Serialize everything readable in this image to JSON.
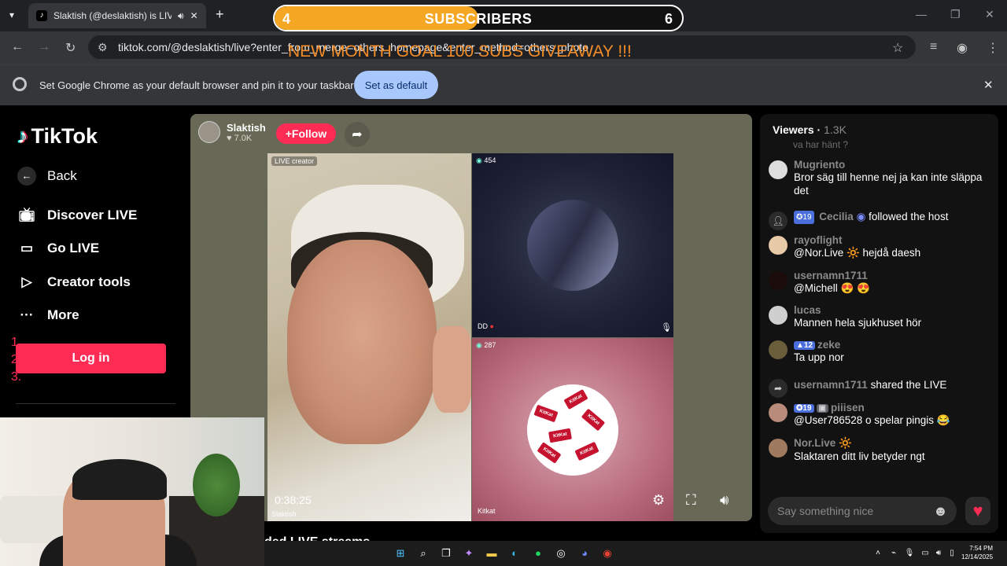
{
  "browser": {
    "tab_title": "Slaktish (@deslaktish) is LIV",
    "url": "tiktok.com/@deslaktish/live?enter_from_merge=others_homepage&enter_method=others_photo",
    "infobar_text": "Set Google Chrome as your default browser and pin it to your taskbar",
    "set_default_label": "Set as default"
  },
  "overlay": {
    "sub_start": "4",
    "sub_label": "SUBSCRIBERS",
    "sub_end": "6",
    "sub_progress": 0.5,
    "goal_text": "NEW MONTH GOAL 100 SUBS GIVEAWAY !!!"
  },
  "sidebar": {
    "logo": "TikTok",
    "back": "Back",
    "items": [
      {
        "label": "Discover LIVE",
        "icon": "tv-icon"
      },
      {
        "label": "Go LIVE",
        "icon": "camera-icon"
      },
      {
        "label": "Creator tools",
        "icon": "play-icon"
      },
      {
        "label": "More",
        "icon": "more-icon"
      }
    ],
    "login": "Log in",
    "numbered": [
      "1.",
      "2.",
      "3."
    ]
  },
  "stream": {
    "creator": "Slaktish",
    "likes": "7.0K",
    "follow": "Follow",
    "main_label": "LIVE creator",
    "timer": "0:38:25",
    "main_name": "Slaktish",
    "top_viewers": "454",
    "top_name": "DD",
    "bottom_viewers": "287",
    "bottom_name": "Kitkat",
    "below_text": "ded LIVE streams"
  },
  "chat": {
    "viewers_label": "Viewers",
    "viewers_count": "1.3K",
    "cut_text": "va har hänt ?",
    "messages": [
      {
        "user": "Mugriento",
        "text": "Bror säg till henne nej ja kan inte släppa det"
      },
      {
        "user": "Cecilia",
        "text": "followed the host",
        "badge": "19"
      },
      {
        "user": "rayoflight",
        "text": "@Nor.Live 🔆 hejdå daesh"
      },
      {
        "user": "usernamn1711",
        "text": "@Michell 😍 😍"
      },
      {
        "user": "lucas",
        "text": "Mannen hela sjukhuset hör"
      },
      {
        "user": "zeke",
        "text": "Ta upp nor",
        "badge": "12"
      },
      {
        "user": "usernamn1711",
        "text": "shared the LIVE"
      },
      {
        "user": "piiisen",
        "text": "@User786528 o spelar pingis 😂",
        "badge": "19"
      },
      {
        "user": "Nor.Live 🔆",
        "text": "Slaktaren ditt liv betyder ngt"
      }
    ],
    "input_placeholder": "Say something nice"
  },
  "taskbar": {
    "time": "7:54 PM",
    "date": "12/14/2025"
  }
}
